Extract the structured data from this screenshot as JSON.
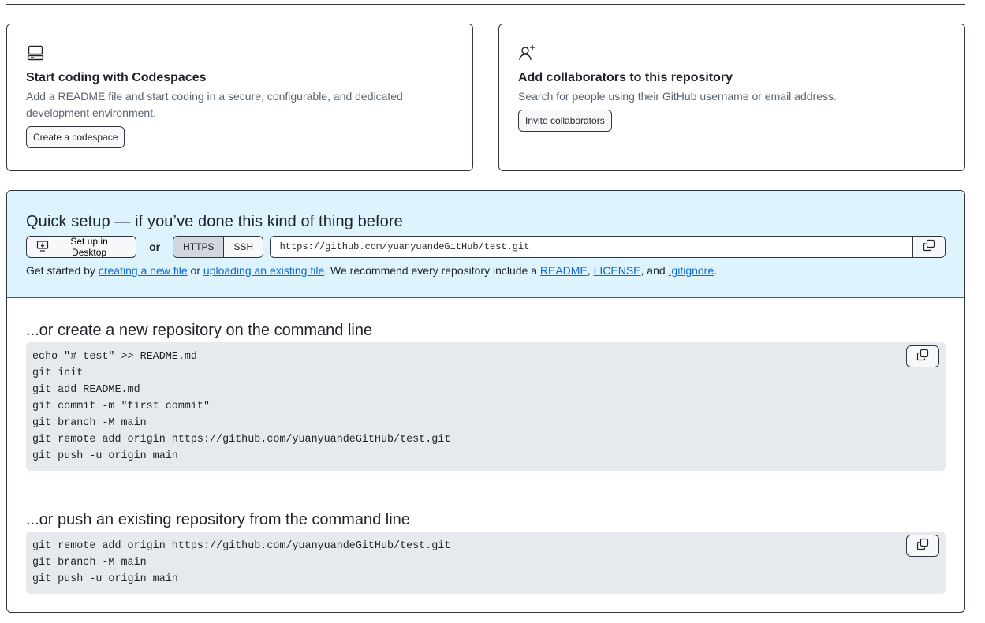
{
  "codespaces": {
    "title": "Start coding with Codespaces",
    "description": "Add a README file and start coding in a secure, configurable, and dedicated development environment.",
    "button": "Create a codespace",
    "icon": "codespaces-icon"
  },
  "collaborators": {
    "title": "Add collaborators to this repository",
    "description": "Search for people using their GitHub username or email address.",
    "button": "Invite collaborators",
    "icon": "person-add-icon"
  },
  "quick_setup": {
    "title": "Quick setup — if you’ve done this kind of thing before",
    "desktop_button": "Set up in Desktop",
    "or": "or",
    "protocols": [
      "HTTPS",
      "SSH"
    ],
    "selected_protocol": "HTTPS",
    "url": "https://github.com/yuanyuandeGitHub/test.git",
    "hint": {
      "prefix": "Get started by ",
      "link1": "creating a new file",
      "mid1": " or ",
      "link2": "uploading an existing file",
      "mid2": ". We recommend every repository include a ",
      "link3": "README",
      "sep1": ", ",
      "link4": "LICENSE",
      "sep2": ", and ",
      "link5": ".gitignore",
      "suffix": "."
    }
  },
  "new_repo": {
    "title": "...or create a new repository on the command line",
    "code": "echo \"# test\" >> README.md\ngit init\ngit add README.md\ngit commit -m \"first commit\"\ngit branch -M main\ngit remote add origin https://github.com/yuanyuandeGitHub/test.git\ngit push -u origin main"
  },
  "existing_repo": {
    "title": "...or push an existing repository from the command line",
    "code": "git remote add origin https://github.com/yuanyuandeGitHub/test.git\ngit branch -M main\ngit push -u origin main"
  },
  "colors": {
    "quick_bg": "#ddf4ff",
    "link": "#0969da",
    "code_bg": "#e6e9ed",
    "border": "#30363d"
  }
}
